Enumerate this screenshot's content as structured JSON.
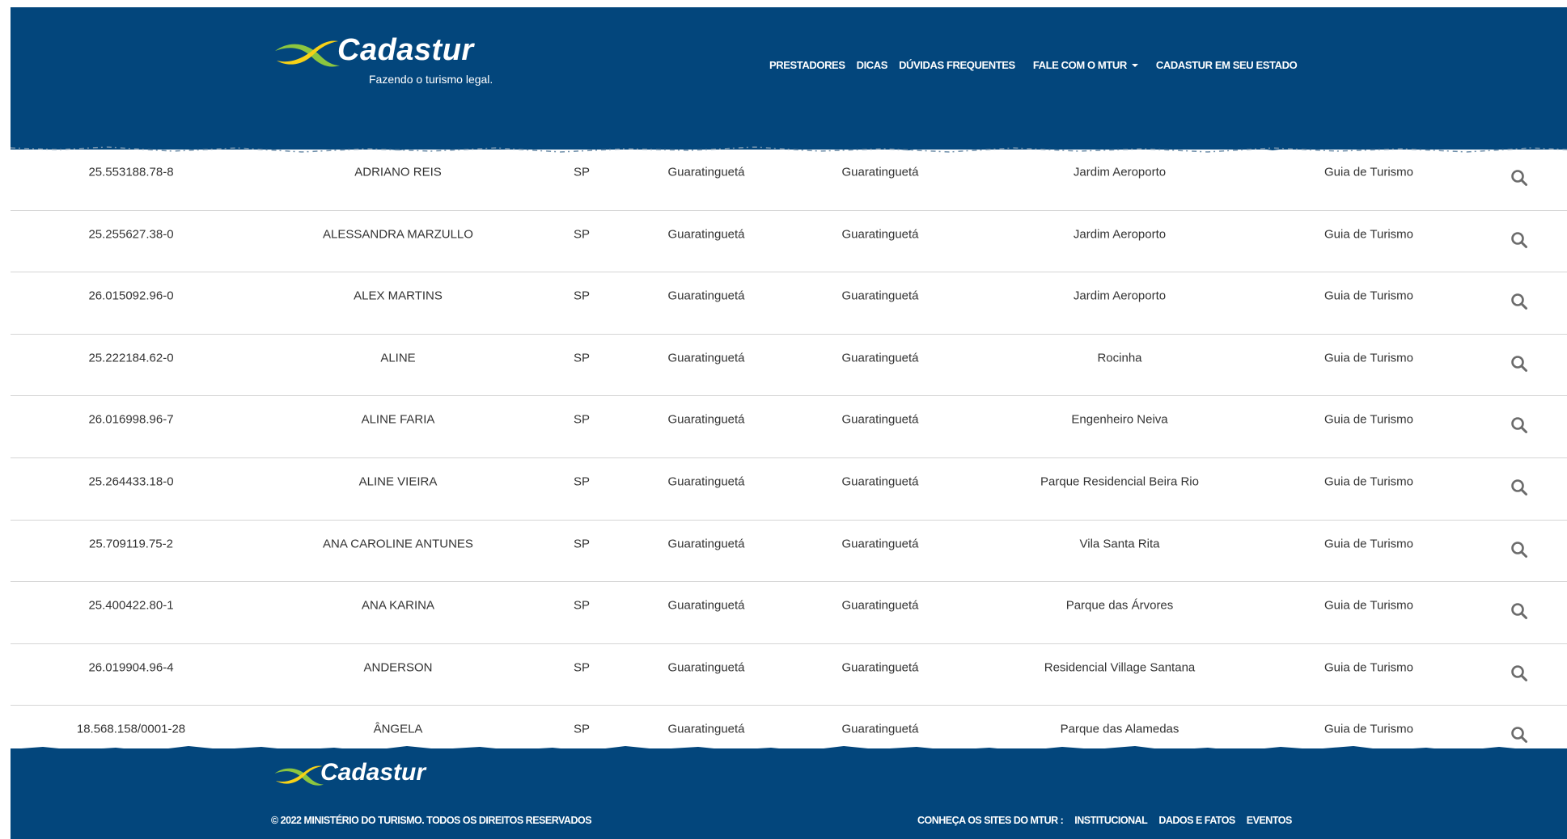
{
  "brand": {
    "name": "Cadastur",
    "tagline": "Fazendo o turismo legal.",
    "colors": {
      "primary": "#03467c",
      "logo_green": "#8cc63f",
      "logo_yellow": "#f7d117"
    }
  },
  "nav": {
    "items": [
      "PRESTADORES",
      "DICAS",
      "DÚVIDAS FREQUENTES",
      "FALE COM O MTUR",
      "CADASTUR EM SEU ESTADO"
    ]
  },
  "table": {
    "rows": [
      [
        "25.553188.78-8",
        "ADRIANO REIS",
        "SP",
        "Guaratinguetá",
        "Guaratinguetá",
        "Jardim Aeroporto",
        "Guia de Turismo"
      ],
      [
        "25.255627.38-0",
        "ALESSANDRA MARZULLO",
        "SP",
        "Guaratinguetá",
        "Guaratinguetá",
        "Jardim Aeroporto",
        "Guia de Turismo"
      ],
      [
        "26.015092.96-0",
        "ALEX MARTINS",
        "SP",
        "Guaratinguetá",
        "Guaratinguetá",
        "Jardim Aeroporto",
        "Guia de Turismo"
      ],
      [
        "25.222184.62-0",
        "ALINE",
        "SP",
        "Guaratinguetá",
        "Guaratinguetá",
        "Rocinha",
        "Guia de Turismo"
      ],
      [
        "26.016998.96-7",
        "ALINE FARIA",
        "SP",
        "Guaratinguetá",
        "Guaratinguetá",
        "Engenheiro Neiva",
        "Guia de Turismo"
      ],
      [
        "25.264433.18-0",
        "ALINE VIEIRA",
        "SP",
        "Guaratinguetá",
        "Guaratinguetá",
        "Parque Residencial Beira Rio",
        "Guia de Turismo"
      ],
      [
        "25.709119.75-2",
        "ANA CAROLINE ANTUNES",
        "SP",
        "Guaratinguetá",
        "Guaratinguetá",
        "Vila Santa Rita",
        "Guia de Turismo"
      ],
      [
        "25.400422.80-1",
        "ANA KARINA",
        "SP",
        "Guaratinguetá",
        "Guaratinguetá",
        "Parque das Árvores",
        "Guia de Turismo"
      ],
      [
        "26.019904.96-4",
        "ANDERSON",
        "SP",
        "Guaratinguetá",
        "Guaratinguetá",
        "Residencial Village Santana",
        "Guia de Turismo"
      ],
      [
        "18.568.158/0001-28",
        "ÂNGELA",
        "SP",
        "Guaratinguetá",
        "Guaratinguetá",
        "Parque das Alamedas",
        "Guia de Turismo"
      ]
    ],
    "row_action_icon": "search-icon"
  },
  "footer": {
    "logo_text": "Cadastur",
    "copyright": "© 2022 MINISTÉRIO DO TURISMO. TODOS OS DIREITOS RESERVADOS",
    "sites_label": "CONHEÇA OS SITES DO MTUR :",
    "links": [
      "INSTITUCIONAL",
      "DADOS E FATOS",
      "EVENTOS"
    ]
  }
}
